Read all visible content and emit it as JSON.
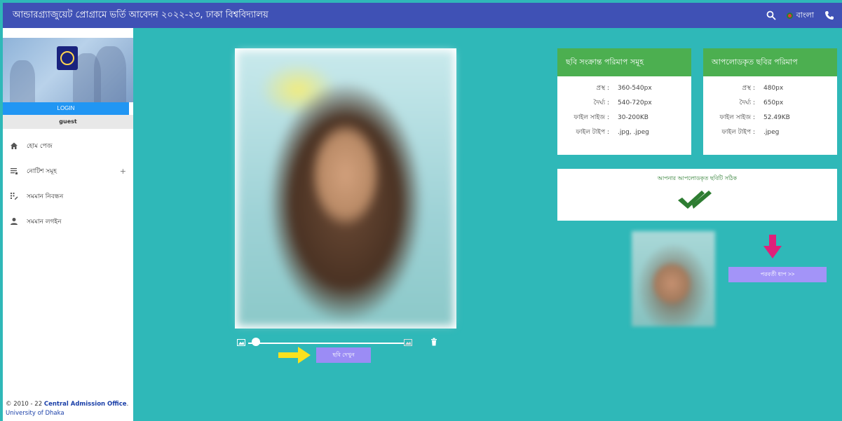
{
  "header": {
    "title": "আন্ডারগ্র্যাজুয়েট প্রোগ্রামে ভর্তি আবেদন ২০২২-২৩, ঢাকা বিশ্ববিদ্যালয়",
    "language_label": "বাংলা",
    "search_icon": "search-icon",
    "phone_icon": "phone-icon"
  },
  "sidebar": {
    "login_label": "LOGIN",
    "user_label": "guest",
    "items": [
      {
        "label": "হোম পেজ",
        "icon": "home-icon"
      },
      {
        "label": "নোটিশ সমূহ",
        "icon": "list-icon",
        "expand": "+"
      },
      {
        "label": "সমমান নিবন্ধন",
        "icon": "register-icon"
      },
      {
        "label": "সমমান লগইন",
        "icon": "person-icon"
      }
    ],
    "footer": {
      "prefix": "© 2010 - 22 ",
      "office": "Central Admission Office",
      "dot": ".",
      "university": "University of Dhaka"
    }
  },
  "photo_editor": {
    "view_button_label": "ছবি দেখুন",
    "zoom_value": 0.05
  },
  "required_card": {
    "title": "ছবি সংক্রান্ত পরিমাপ সমূহ",
    "rows": [
      {
        "key": "প্রস্থ :",
        "value": "360-540px"
      },
      {
        "key": "দৈর্ঘ্য :",
        "value": "540-720px"
      },
      {
        "key": "ফাইল সাইজ :",
        "value": "30-200KB"
      },
      {
        "key": "ফাইল টাইপ :",
        "value": ".jpg, .jpeg"
      }
    ]
  },
  "uploaded_card": {
    "title": "আপলোডকৃত ছবির পরিমাপ",
    "rows": [
      {
        "key": "প্রস্থ :",
        "value": "480px"
      },
      {
        "key": "দৈর্ঘ্য :",
        "value": "650px"
      },
      {
        "key": "ফাইল সাইজ :",
        "value": "52.49KB"
      },
      {
        "key": "ফাইল টাইপ :",
        "value": ".jpeg"
      }
    ]
  },
  "validation": {
    "message": "আপনার আপলোডকৃত ছবিটি সঠিক"
  },
  "next_button_label": "পরবর্তী ধাপ >>",
  "colors": {
    "topbar": "#3f51b5",
    "background": "#2fb8b8",
    "card_header": "#4caf50",
    "button": "#9b8cf5",
    "arrow_yellow": "#f9e11e",
    "arrow_pink": "#e0207a",
    "check": "#2e7d32"
  }
}
